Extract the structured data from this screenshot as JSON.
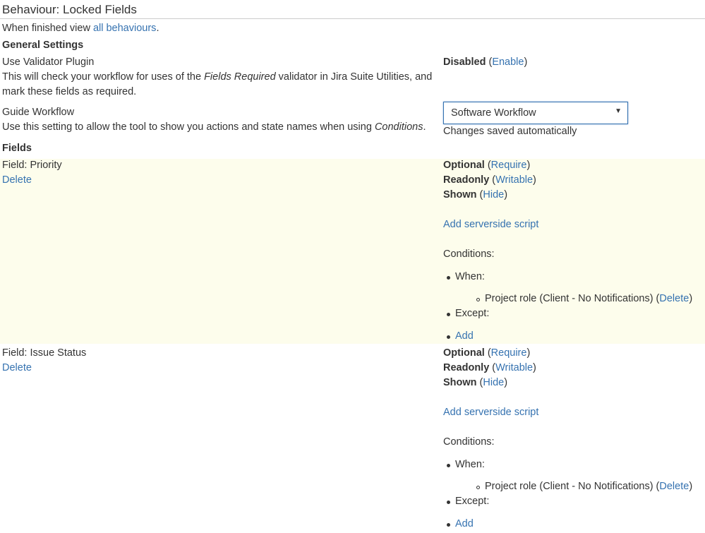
{
  "header": {
    "title": "Behaviour: Locked Fields"
  },
  "intro": {
    "prefix": "When finished view ",
    "link": "all behaviours",
    "suffix": "."
  },
  "general": {
    "heading": "General Settings",
    "validator": {
      "label": "Use Validator Plugin",
      "desc_1": "This will check your workflow for uses of the ",
      "desc_em": "Fields Required",
      "desc_2": " validator in Jira Suite Utilities, and mark these fields as required.",
      "status": "Disabled",
      "action": "Enable"
    },
    "workflow": {
      "label": "Guide Workflow",
      "desc_1": "Use this setting to allow the tool to show you actions and state names when using ",
      "desc_em": "Conditions",
      "desc_2": ".",
      "selected": "Software Workflow",
      "saved_note": "Changes saved automatically"
    }
  },
  "fields_heading": "Fields",
  "fields": [
    {
      "name": "Field: Priority",
      "delete": "Delete",
      "optional": "Optional",
      "require": "Require",
      "readonly": "Readonly",
      "writable": "Writable",
      "shown": "Shown",
      "hide": "Hide",
      "add_script": "Add serverside script",
      "conditions": "Conditions:",
      "when": "When:",
      "condition_item": "Project role (Client - No Notifications) (",
      "condition_delete": "Delete",
      "condition_close": ")",
      "except": "Except:",
      "add": "Add"
    },
    {
      "name": "Field: Issue Status",
      "delete": "Delete",
      "optional": "Optional",
      "require": "Require",
      "readonly": "Readonly",
      "writable": "Writable",
      "shown": "Shown",
      "hide": "Hide",
      "add_script": "Add serverside script",
      "conditions": "Conditions:",
      "when": "When:",
      "condition_item": "Project role (Client - No Notifications) (",
      "condition_delete": "Delete",
      "condition_close": ")",
      "except": "Except:",
      "add": "Add"
    }
  ],
  "colors": {
    "link": "#3572b0",
    "highlight": "#fdfdec",
    "text": "#333333"
  }
}
